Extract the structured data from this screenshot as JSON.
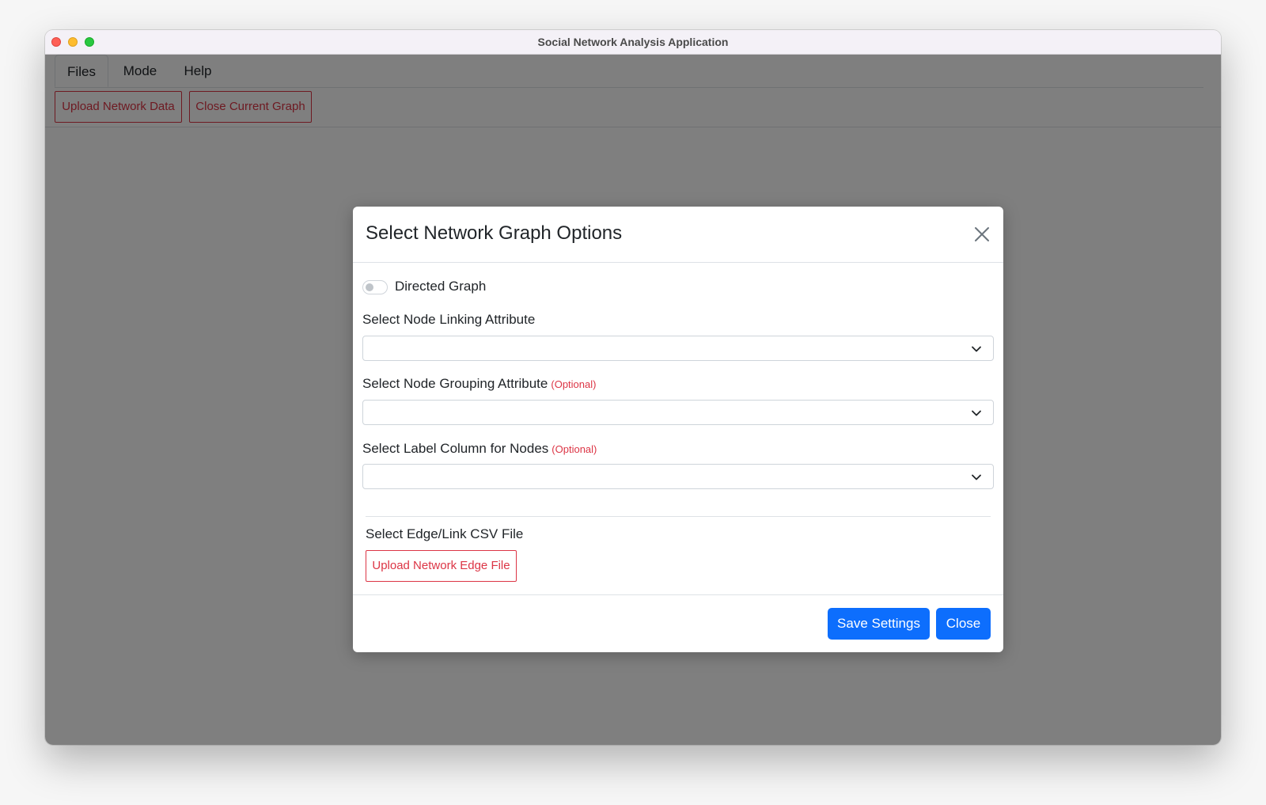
{
  "window": {
    "title": "Social Network Analysis Application"
  },
  "menu": {
    "tabs": [
      {
        "label": "Files",
        "active": true
      },
      {
        "label": "Mode",
        "active": false
      },
      {
        "label": "Help",
        "active": false
      }
    ]
  },
  "toolbar": {
    "upload_label": "Upload Network Data",
    "close_graph_label": "Close Current Graph"
  },
  "modal": {
    "title": "Select Network Graph Options",
    "close_icon": "close-icon",
    "directed": {
      "label": "Directed Graph",
      "checked": false
    },
    "fields": [
      {
        "label": "Select Node Linking Attribute",
        "optional": "",
        "value": ""
      },
      {
        "label": "Select Node Grouping Attribute",
        "optional": "(Optional)",
        "value": ""
      },
      {
        "label": "Select Label Column for Nodes",
        "optional": "(Optional)",
        "value": ""
      }
    ],
    "edge_section": {
      "label": "Select Edge/Link CSV File",
      "button_label": "Upload Network Edge File"
    },
    "footer": {
      "save_label": "Save Settings",
      "close_label": "Close"
    }
  },
  "colors": {
    "primary": "#0d6efd",
    "danger": "#dc3545",
    "backdrop": "rgba(0,0,0,0.5)"
  }
}
